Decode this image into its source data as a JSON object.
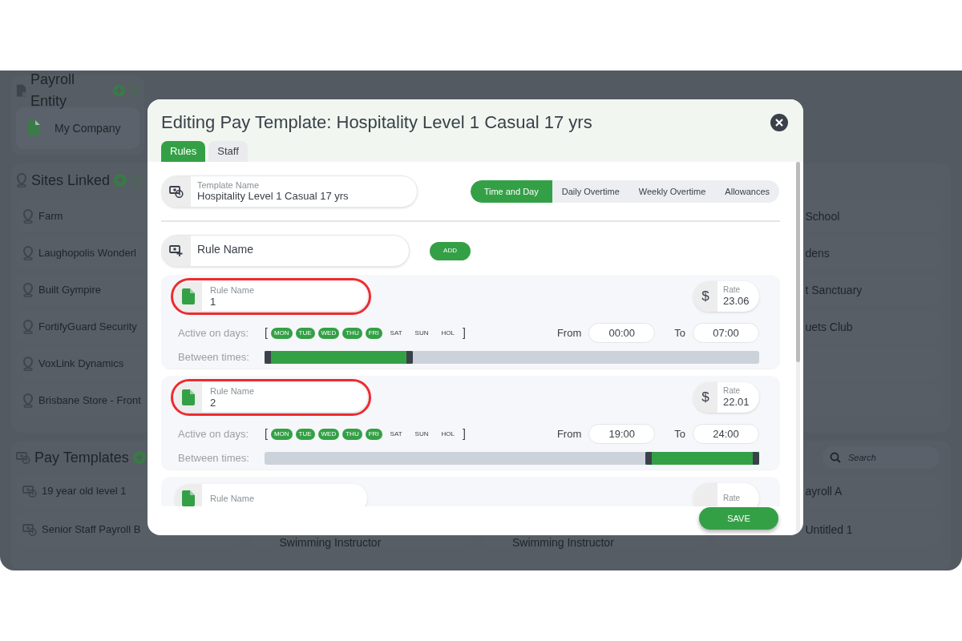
{
  "background": {
    "payroll_entity": {
      "title": "Payroll Entity",
      "items": [
        "My Company"
      ]
    },
    "sites_linked": {
      "title": "Sites Linked",
      "rows": [
        {
          "column_1": "Farm",
          "column_4": "School"
        },
        {
          "column_1": "Laughopolis Wonderl",
          "column_4": "dens"
        },
        {
          "column_1": "Built Gympire",
          "column_4": "t Sanctuary"
        },
        {
          "column_1": "FortifyGuard Security",
          "column_4": "uets Club"
        },
        {
          "column_1": "VoxLink Dynamics"
        },
        {
          "column_1": "Brisbane Store - Front"
        }
      ]
    },
    "pay_templates": {
      "title": "Pay Templates",
      "search_placeholder": "Search",
      "rows": [
        {
          "column_1": "19 year old level 1",
          "column_4": "ayroll A"
        },
        {
          "column_1": "Senior Staff Payroll B",
          "column_2": "Swimming Instructor",
          "column_3": "Swimming Instructor",
          "column_4": "Untitled 1"
        }
      ]
    }
  },
  "modal": {
    "title": "Editing Pay Template: Hospitality Level 1 Casual 17 yrs",
    "tabs": [
      {
        "label": "Rules",
        "selected": true
      },
      {
        "label": "Staff",
        "selected": false
      }
    ],
    "template_name": {
      "label": "Template Name",
      "value": "Hospitality Level 1 Casual 17 yrs"
    },
    "sections": [
      {
        "label": "Time and Day",
        "selected": true
      },
      {
        "label": "Daily Overtime",
        "selected": false
      },
      {
        "label": "Weekly Overtime",
        "selected": false
      },
      {
        "label": "Allowances",
        "selected": false
      }
    ],
    "new_rule": {
      "placeholder": "Rule Name",
      "button": "ADD"
    },
    "rules": [
      {
        "highlighted": true,
        "name_label": "Rule Name",
        "name": "1",
        "currency": "$",
        "rate_label": "Rate",
        "rate": "23.06",
        "days_label": "Active on days:",
        "open_bracket": "[",
        "days": [
          {
            "label": "MON",
            "active": true
          },
          {
            "label": "TUE",
            "active": true
          },
          {
            "label": "WED",
            "active": true
          },
          {
            "label": "THU",
            "active": true
          },
          {
            "label": "FRI",
            "active": true
          },
          {
            "label": "SAT",
            "active": false
          },
          {
            "label": "SUN",
            "active": false
          },
          {
            "label": "HOL",
            "active": false
          }
        ],
        "close_bracket": "]",
        "from_label": "From",
        "from": "00:00",
        "to_label": "To",
        "to": "07:00",
        "times_label": "Between times:",
        "handles": [
          {
            "level": 0
          },
          {
            "level": 0.29
          }
        ]
      },
      {
        "highlighted": true,
        "name_label": "Rule Name",
        "name": "2",
        "currency": "$",
        "rate_label": "Rate",
        "rate": "22.01",
        "days_label": "Active on days:",
        "open_bracket": "[",
        "days": [
          {
            "label": "MON",
            "active": true
          },
          {
            "label": "TUE",
            "active": true
          },
          {
            "label": "WED",
            "active": true
          },
          {
            "label": "THU",
            "active": true
          },
          {
            "label": "FRI",
            "active": true
          },
          {
            "label": "SAT",
            "active": false
          },
          {
            "label": "SUN",
            "active": false
          },
          {
            "label": "HOL",
            "active": false
          }
        ],
        "close_bracket": "]",
        "from_label": "From",
        "from": "19:00",
        "to_label": "To",
        "to": "24:00",
        "times_label": "Between times:",
        "handles": [
          {
            "level": 0.78
          },
          {
            "level": 1
          }
        ]
      },
      {
        "highlighted": false,
        "name_label": "Rule Name",
        "rate_label": "Rate"
      }
    ],
    "save_button": "SAVE"
  }
}
